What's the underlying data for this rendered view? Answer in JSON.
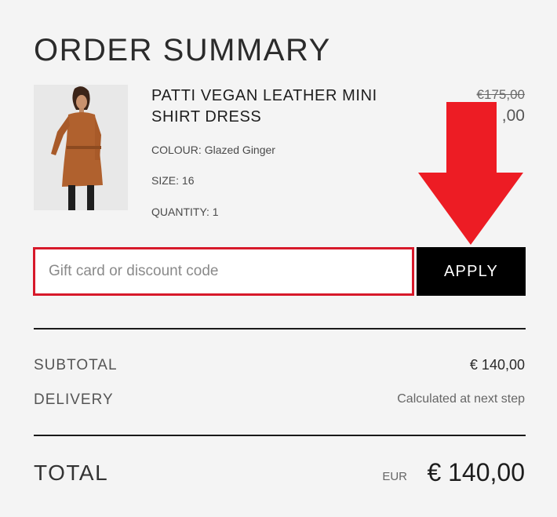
{
  "order_summary": {
    "title": "ORDER SUMMARY",
    "item": {
      "name": "PATTI VEGAN LEATHER MINI SHIRT DRESS",
      "colour_label": "COLOUR:",
      "colour": "Glazed Ginger",
      "size_label": "SIZE:",
      "size": "16",
      "quantity_label": "QUANTITY:",
      "quantity": "1",
      "original_price": "€175,00",
      "sale_price_visible": ",00"
    },
    "discount": {
      "placeholder": "Gift card or discount code",
      "value": "",
      "apply_label": "APPLY"
    },
    "subtotal_label": "SUBTOTAL",
    "subtotal_value": "€ 140,00",
    "delivery_label": "DELIVERY",
    "delivery_value": "Calculated at next step",
    "total_label": "TOTAL",
    "total_currency": "EUR",
    "total_value": "€ 140,00"
  },
  "colors": {
    "highlight_border": "#d7192a",
    "annotation_arrow": "#ed1c24",
    "apply_button_bg": "#000000"
  },
  "annotation": {
    "icon": "down-arrow-icon"
  }
}
